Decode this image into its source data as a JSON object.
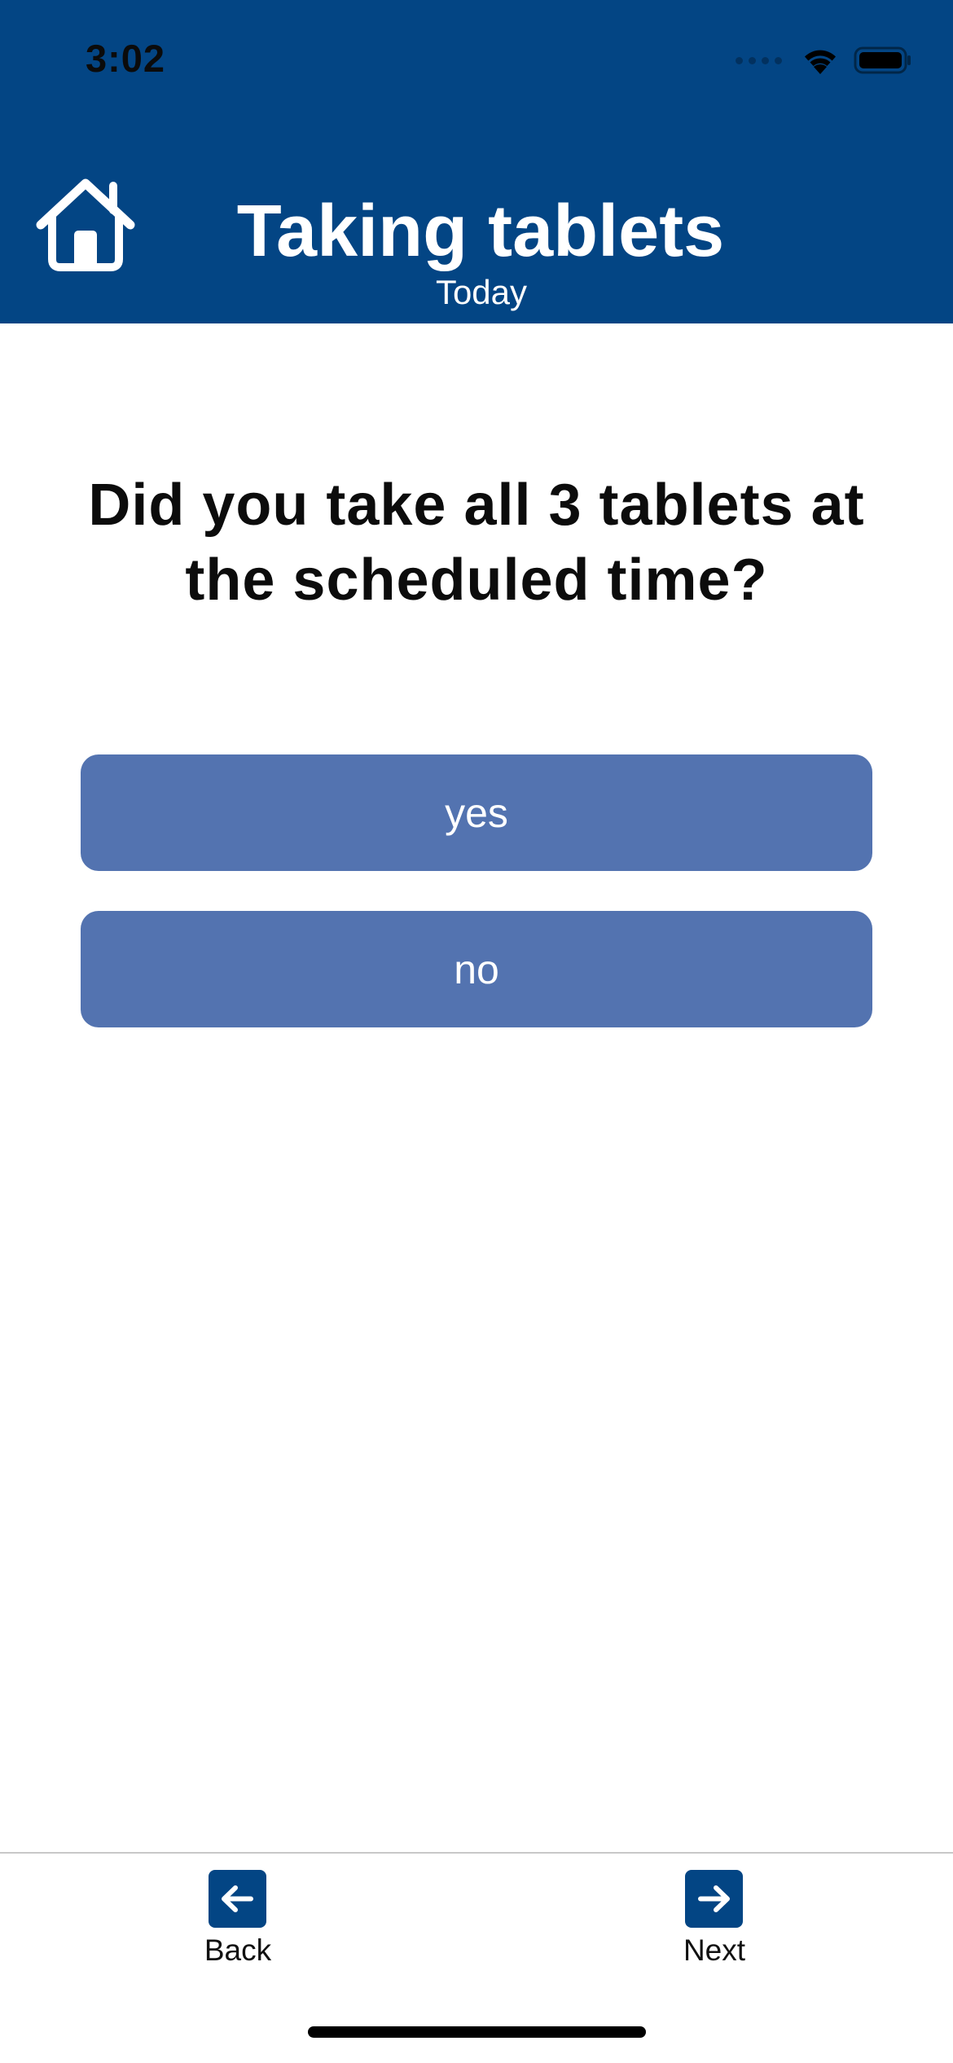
{
  "status_bar": {
    "time": "3:02",
    "icons": [
      "signal-dots-icon",
      "wifi-icon",
      "battery-icon"
    ]
  },
  "header": {
    "title": "Taking tablets",
    "subtitle": "Today",
    "home_icon": "home-icon",
    "background_color": "#034584"
  },
  "main": {
    "question": "Did you take all 3 tablets at the scheduled time?",
    "answers": [
      {
        "label": "yes"
      },
      {
        "label": "no"
      }
    ],
    "answer_color": "#5373b0"
  },
  "footer": {
    "back_label": "Back",
    "back_icon": "arrow-left-icon",
    "next_label": "Next",
    "next_icon": "arrow-right-icon"
  }
}
